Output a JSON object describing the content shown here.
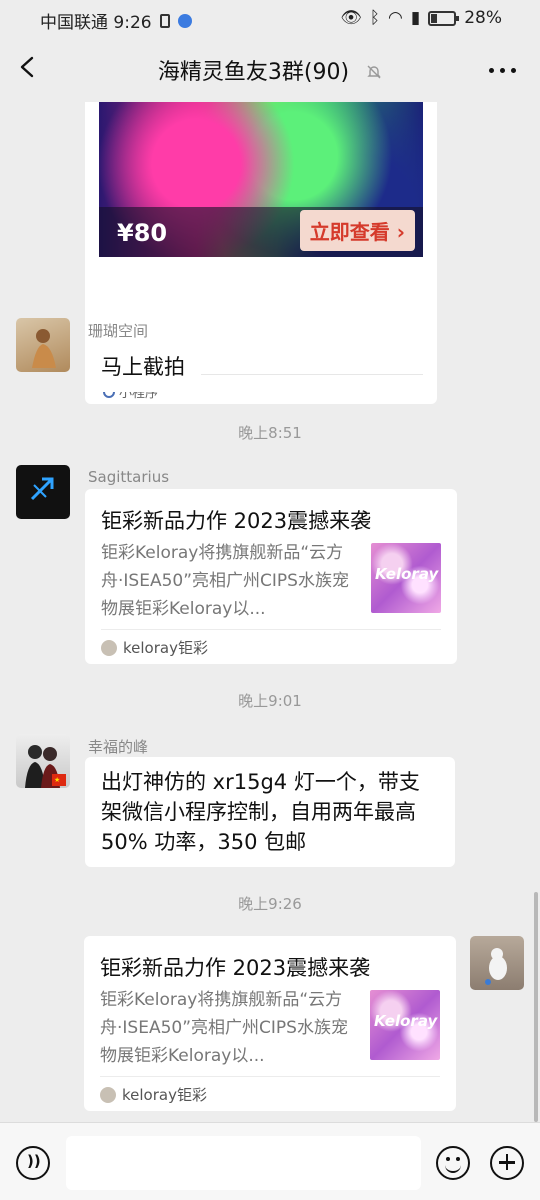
{
  "status": {
    "carrier_time": "中国联通 9:26",
    "battery": "28%",
    "battery_level": 0.28
  },
  "header": {
    "title": "海精灵鱼友3群(90)"
  },
  "messages": {
    "mini_program": {
      "price": "¥80",
      "button": "立即查看 ›",
      "label": "小程序"
    },
    "m1": {
      "sender": "珊瑚空间",
      "text": "马上截拍"
    },
    "t1": "晚上8:51",
    "m2": {
      "sender": "Sagittarius",
      "title": "钜彩新品力作 2023震撼来袭",
      "desc": "钜彩Keloray将携旗舰新品“云方舟·ISEA50”亮相广州CIPS水族宠物展钜彩Keloray以...",
      "thumb": "Keloray",
      "source": "keloray钜彩"
    },
    "t2": "晚上9:01",
    "m3": {
      "sender": "幸福的峰",
      "text": "出灯神仿的 xr15g4 灯一个，带支架微信小程序控制，自用两年最高50% 功率，350 包邮"
    },
    "t3": "晚上9:26",
    "m4": {
      "title": "钜彩新品力作 2023震撼来袭",
      "desc": "钜彩Keloray将携旗舰新品“云方舟·ISEA50”亮相广州CIPS水族宠物展钜彩Keloray以...",
      "thumb": "Keloray",
      "source": "keloray钜彩"
    }
  },
  "icons": [
    "back-arrow-icon",
    "mute-bell-icon",
    "more-icon",
    "voice-icon",
    "emoji-icon",
    "plus-icon",
    "mini-program-icon"
  ]
}
